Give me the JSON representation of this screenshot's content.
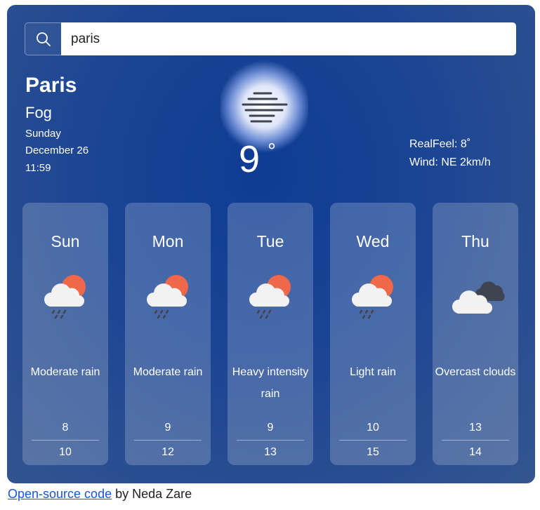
{
  "search": {
    "value": "paris",
    "icon": "search-icon"
  },
  "current": {
    "city": "Paris",
    "description": "Fog",
    "day": "Sunday",
    "date": "December 26",
    "time": "11:59",
    "temperature": "9",
    "degree_symbol": "°",
    "icon": "fog-icon",
    "realfeel": "RealFeel: 8˚",
    "wind": "Wind: NE 2km/h"
  },
  "forecast": [
    {
      "day": "Sun",
      "description": "Moderate rain",
      "min": "8",
      "max": "10",
      "icon": "sun-cloud-rain-icon"
    },
    {
      "day": "Mon",
      "description": "Moderate rain",
      "min": "9",
      "max": "12",
      "icon": "sun-cloud-rain-icon"
    },
    {
      "day": "Tue",
      "description": "Heavy intensity rain",
      "min": "9",
      "max": "13",
      "icon": "sun-cloud-rain-icon"
    },
    {
      "day": "Wed",
      "description": "Light rain",
      "min": "10",
      "max": "15",
      "icon": "sun-cloud-rain-icon"
    },
    {
      "day": "Thu",
      "description": "Overcast clouds",
      "min": "13",
      "max": "14",
      "icon": "overcast-clouds-icon"
    }
  ],
  "footer": {
    "link_text": "Open-source code",
    "suffix": " by Neda Zare"
  },
  "colors": {
    "background": "#1a4494",
    "card": "rgba(255,255,255,0.2)",
    "sun": "#f0684a",
    "link": "#1a55d8"
  }
}
